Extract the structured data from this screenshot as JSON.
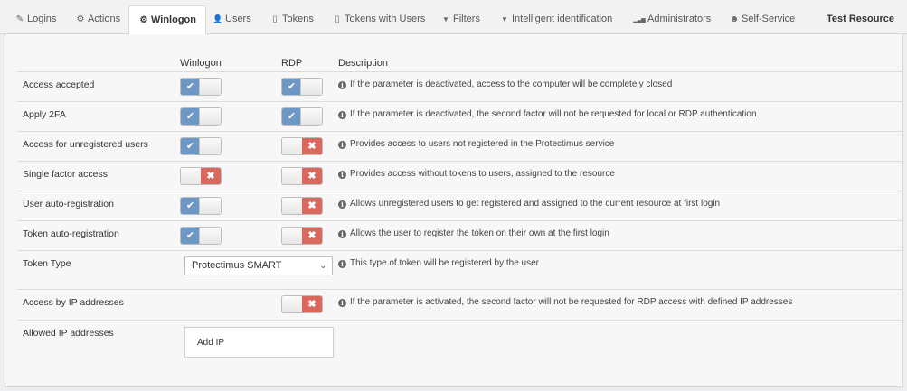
{
  "tabs": [
    {
      "label": "Logins",
      "icon": "edit-icon",
      "glyph": "✎",
      "active": false
    },
    {
      "label": "Actions",
      "icon": "gear-icon",
      "glyph": "⚙",
      "active": false
    },
    {
      "label": "Winlogon",
      "icon": "gear-icon",
      "glyph": "⚙",
      "active": true
    },
    {
      "label": "Users",
      "icon": "user-icon",
      "glyph": "👤",
      "active": false
    },
    {
      "label": "Tokens",
      "icon": "mobile-icon",
      "glyph": "▯",
      "active": false
    },
    {
      "label": "Tokens with Users",
      "icon": "mobile-icon",
      "glyph": "▯",
      "active": false
    },
    {
      "label": "Filters",
      "icon": "filter-icon",
      "glyph": "▼",
      "active": false
    },
    {
      "label": "Intelligent identification",
      "icon": "filter-icon",
      "glyph": "▼",
      "active": false
    },
    {
      "label": "Administrators",
      "icon": "signal-icon",
      "glyph": "▂▄▆",
      "active": false
    },
    {
      "label": "Self-Service",
      "icon": "user-secret-icon",
      "glyph": "☻",
      "active": false
    }
  ],
  "resource_title": "Test Resource",
  "headers": {
    "winlogon": "Winlogon",
    "rdp": "RDP",
    "description": "Description"
  },
  "rows": [
    {
      "label": "Access accepted",
      "winlogon": true,
      "rdp": true,
      "description": "If the parameter is deactivated, access to the computer will be completely closed"
    },
    {
      "label": "Apply 2FA",
      "winlogon": true,
      "rdp": true,
      "description": "If the parameter is deactivated, the second factor will not be requested for local or RDP authentication"
    },
    {
      "label": "Access for unregistered users",
      "winlogon": true,
      "rdp": false,
      "description": "Provides access to users not registered in the Protectimus service"
    },
    {
      "label": "Single factor access",
      "winlogon": false,
      "rdp": false,
      "description": "Provides access without tokens to users, assigned to the resource"
    },
    {
      "label": "User auto-registration",
      "winlogon": true,
      "rdp": false,
      "description": "Allows unregistered users to get registered and assigned to the current resource at first login"
    },
    {
      "label": "Token auto-registration",
      "winlogon": true,
      "rdp": false,
      "description": "Allows the user to register the token on their own at the first login"
    }
  ],
  "token_type": {
    "label": "Token Type",
    "value": "Protectimus SMART",
    "description": "This type of token will be registered by the user"
  },
  "ip_access": {
    "label": "Access by IP addresses",
    "rdp": false,
    "description": "If the parameter is activated, the second factor will not be requested for RDP access with defined IP addresses"
  },
  "allowed_ips": {
    "label": "Allowed IP addresses",
    "add_label": "Add IP"
  },
  "colors": {
    "on": "#6d98c6",
    "off": "#d9695f"
  }
}
